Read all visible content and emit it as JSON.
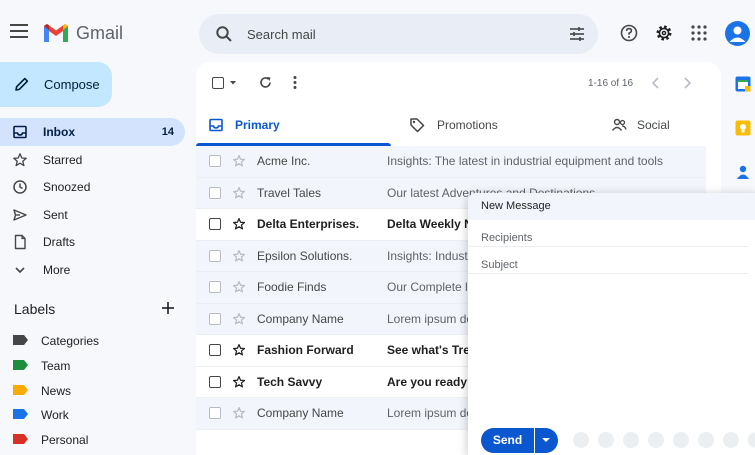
{
  "app": {
    "brand": "Gmail"
  },
  "search": {
    "placeholder": "Search mail"
  },
  "compose_button": {
    "label": "Compose"
  },
  "sidebar": {
    "items": [
      {
        "label": "Inbox",
        "count": "14",
        "icon": "inbox-icon",
        "active": true
      },
      {
        "label": "Starred",
        "count": "",
        "icon": "star-icon"
      },
      {
        "label": "Snoozed",
        "count": "",
        "icon": "clock-icon"
      },
      {
        "label": "Sent",
        "count": "",
        "icon": "send-icon"
      },
      {
        "label": "Drafts",
        "count": "",
        "icon": "draft-icon"
      },
      {
        "label": "More",
        "count": "",
        "icon": "chevron-down-icon"
      }
    ],
    "labels_heading": "Labels",
    "labels": [
      {
        "label": "Categories",
        "color": "#444746"
      },
      {
        "label": "Team",
        "color": "#1e8e3e"
      },
      {
        "label": "News",
        "color": "#f9ab00"
      },
      {
        "label": "Work",
        "color": "#1a73e8"
      },
      {
        "label": "Personal",
        "color": "#d93025"
      }
    ]
  },
  "toolbar": {
    "pagination": "1-16 of 16"
  },
  "tabs": [
    {
      "label": "Primary",
      "active": true
    },
    {
      "label": "Promotions"
    },
    {
      "label": "Social"
    }
  ],
  "emails": [
    {
      "sender": "Acme Inc.",
      "subject": "Insights: The latest in industrial equipment and tools",
      "unread": false
    },
    {
      "sender": "Travel Tales",
      "subject": "Our latest Adventures and Destinations",
      "unread": false
    },
    {
      "sender": "Delta Enterprises.",
      "subject": "Delta Weekly Newsletter",
      "unread": true
    },
    {
      "sender": "Epsilon Solutions.",
      "subject": "Insights: Industry updates",
      "unread": false
    },
    {
      "sender": "Foodie Finds",
      "subject": "Our Complete list of recipes",
      "unread": false
    },
    {
      "sender": "Company Name",
      "subject": "Lorem ipsum dolor sit amet",
      "unread": false
    },
    {
      "sender": "Fashion Forward",
      "subject": "See what's Trending",
      "unread": true
    },
    {
      "sender": "Tech Savvy",
      "subject": "Are you ready to upgrade?",
      "unread": true
    },
    {
      "sender": "Company Name",
      "subject": "Lorem ipsum dolor sit amet",
      "unread": false
    }
  ],
  "compose_window": {
    "title": "New Message",
    "recipients_placeholder": "Recipients",
    "subject_placeholder": "Subject",
    "send_label": "Send"
  },
  "colors": {
    "accent": "#0b57d0",
    "compose_bg": "#c2e7ff",
    "active_nav": "#d3e3fd"
  }
}
